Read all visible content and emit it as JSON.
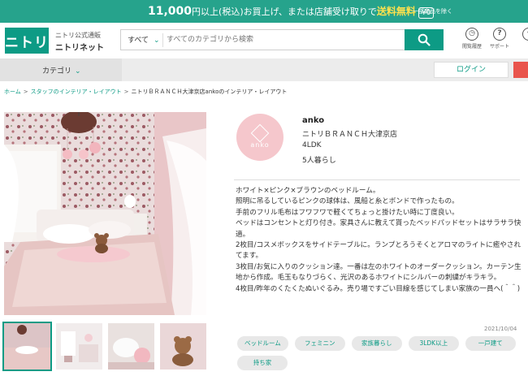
{
  "promo": {
    "amount": "11,000",
    "text_a": "円以上(税込)お買上げ、または店舗受け取りで",
    "free_text": "送料無料",
    "tag": "¥0",
    "sub_text": "一部商品を除く"
  },
  "header": {
    "site_line1": "ニトリ公式通販",
    "site_line2": "ニトリネット",
    "logo_text": "ニトリ",
    "search_category": "すべて",
    "search_placeholder": "すべてのカテゴリから検索",
    "icons": [
      {
        "name": "browsing-history",
        "label": "閲覧履歴"
      },
      {
        "name": "support",
        "label": "サポート"
      },
      {
        "name": "store",
        "label": ""
      }
    ]
  },
  "nav": {
    "category_label": "カテゴリ",
    "login_label": "ログイン"
  },
  "breadcrumb": {
    "home": "ホーム",
    "staff_interior": "スタッフのインテリア・レイアウト",
    "current": "ニトリＢＲＡＮＣＨ大津京店ankoのインテリア・レイアウト",
    "sep": ">"
  },
  "profile": {
    "avatar_text": "anko",
    "name": "anko",
    "store": "ニトリＢＲＡＮＣＨ大津京店",
    "layout": "4LDK",
    "household": "5人暮らし"
  },
  "description": [
    "ホワイト×ピンク×ブラウンのベッドルーム。",
    "照明に吊るしているピンクの球体は、風船と糸とボンドで作ったもの。",
    "手前のフリル毛布はフワフワで軽くてちょっと掛けたい時に丁度良い。",
    "ベッドはコンセントと灯り付き。家具さんに教えて貰ったベッドパッドセットはサラサラ快適。",
    "2枚目/コスメボックスをサイドテーブルに。ランプとろうそくとアロマのライトに癒やされてます。",
    "3枚目/お気に入りのクッション達。一番は左のホワイトのオーダークッション。カーテン生地から作成。毛玉もなりづらく、光沢のあるホワイトにシルバーの刺繍がキラキラ。",
    "4枚目/昨年のくたくたぬいぐるみ。売り場ですごい目線を感じてしまい家族の一員へ(＾＾)"
  ],
  "date": "2021/10/04",
  "tags": [
    "ベッドルーム",
    "フェミニン",
    "家族暮らし",
    "3LDK以上",
    "一戸建て",
    "持ち家"
  ],
  "colors": {
    "brand": "#0d9b85",
    "promo_bg": "#26a38c",
    "accent_red": "#e9544c",
    "avatar_pink": "#f5c7cc"
  }
}
